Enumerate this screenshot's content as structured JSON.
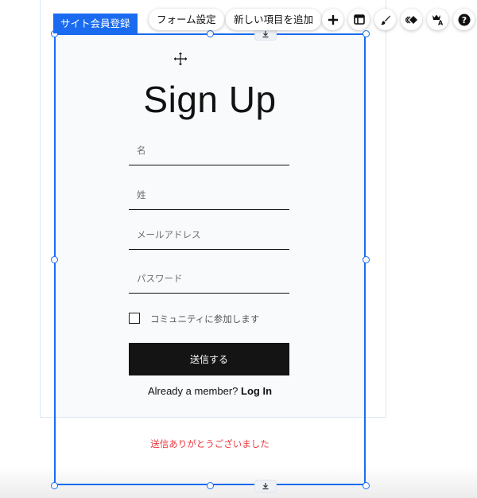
{
  "toolbar": {
    "site_tag": "サイト会員登録",
    "form_settings": "フォーム設定",
    "add_new_field": "新しい項目を追加",
    "icons": [
      "plus-icon",
      "layout-icon",
      "brush-icon",
      "animation-icon",
      "text-style-icon",
      "help-icon"
    ]
  },
  "form": {
    "title": "Sign Up",
    "fields": {
      "first_name_placeholder": "名",
      "last_name_placeholder": "姓",
      "email_placeholder": "メールアドレス",
      "password_placeholder": "パスワード"
    },
    "community_checkbox_label": "コミュニティに参加します",
    "community_checked": false,
    "submit_label": "送信する",
    "already_member_text": "Already a member?",
    "login_link": "Log In",
    "success_message": "送信ありがとうございました"
  },
  "colors": {
    "selection": "#1a6bf0",
    "button_bg": "#141414",
    "success_text": "#e8383d"
  }
}
